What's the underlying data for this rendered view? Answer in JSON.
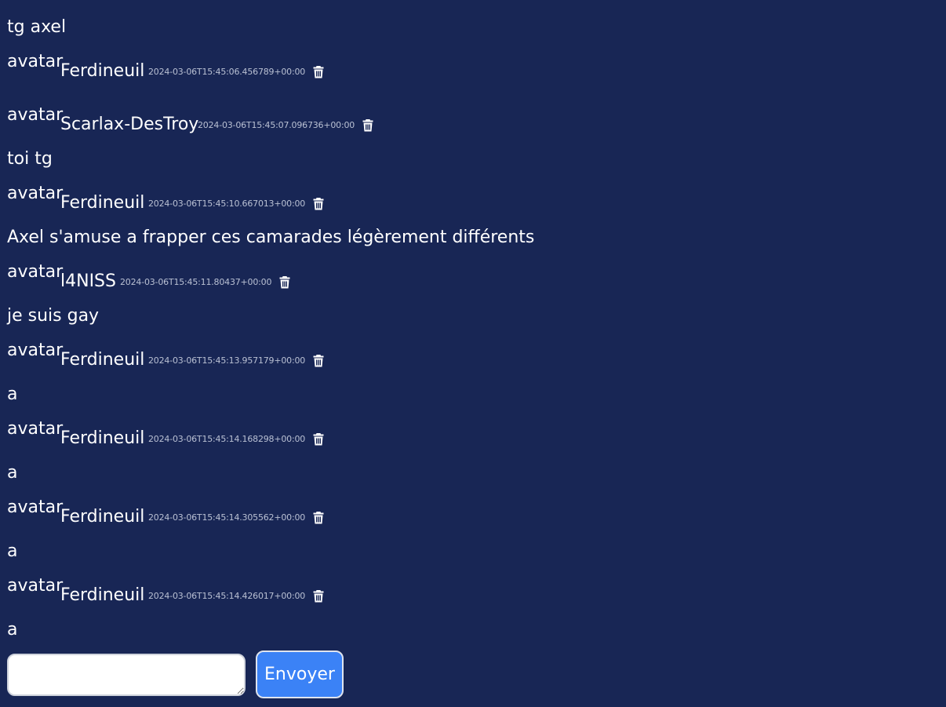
{
  "colors": {
    "background": "#182655",
    "text": "#ffffff",
    "timestamp": "#b9c0d3",
    "send_button": "#3b82f6"
  },
  "messages": [
    {
      "type": "text",
      "text": "tg axel"
    },
    {
      "type": "header",
      "avatar_alt": "avatar",
      "author": "Ferdineuil",
      "timestamp": "2024-03-06T15:45:06.456789+00:00",
      "icon": "trash-icon"
    },
    {
      "type": "header",
      "avatar_alt": "avatar",
      "author": "Scarlax-DesTroy",
      "timestamp": "2024-03-06T15:45:07.096736+00:00",
      "icon": "trash-icon"
    },
    {
      "type": "text",
      "text": "toi tg"
    },
    {
      "type": "header",
      "avatar_alt": "avatar",
      "author": "Ferdineuil",
      "timestamp": "2024-03-06T15:45:10.667013+00:00",
      "icon": "trash-icon"
    },
    {
      "type": "text",
      "text": "Axel s'amuse a frapper ces camarades légèrement différents"
    },
    {
      "type": "header",
      "avatar_alt": "avatar",
      "author": "l4NISS",
      "timestamp": "2024-03-06T15:45:11.80437+00:00",
      "icon": "trash-icon"
    },
    {
      "type": "text",
      "text": "je suis gay"
    },
    {
      "type": "header",
      "avatar_alt": "avatar",
      "author": "Ferdineuil",
      "timestamp": "2024-03-06T15:45:13.957179+00:00",
      "icon": "trash-icon"
    },
    {
      "type": "text",
      "text": "a"
    },
    {
      "type": "header",
      "avatar_alt": "avatar",
      "author": "Ferdineuil",
      "timestamp": "2024-03-06T15:45:14.168298+00:00",
      "icon": "trash-icon"
    },
    {
      "type": "text",
      "text": "a"
    },
    {
      "type": "header",
      "avatar_alt": "avatar",
      "author": "Ferdineuil",
      "timestamp": "2024-03-06T15:45:14.305562+00:00",
      "icon": "trash-icon"
    },
    {
      "type": "text",
      "text": "a"
    },
    {
      "type": "header",
      "avatar_alt": "avatar",
      "author": "Ferdineuil",
      "timestamp": "2024-03-06T15:45:14.426017+00:00",
      "icon": "trash-icon"
    },
    {
      "type": "text",
      "text": "a"
    }
  ],
  "composer": {
    "input_value": "",
    "send_label": "Envoyer"
  }
}
